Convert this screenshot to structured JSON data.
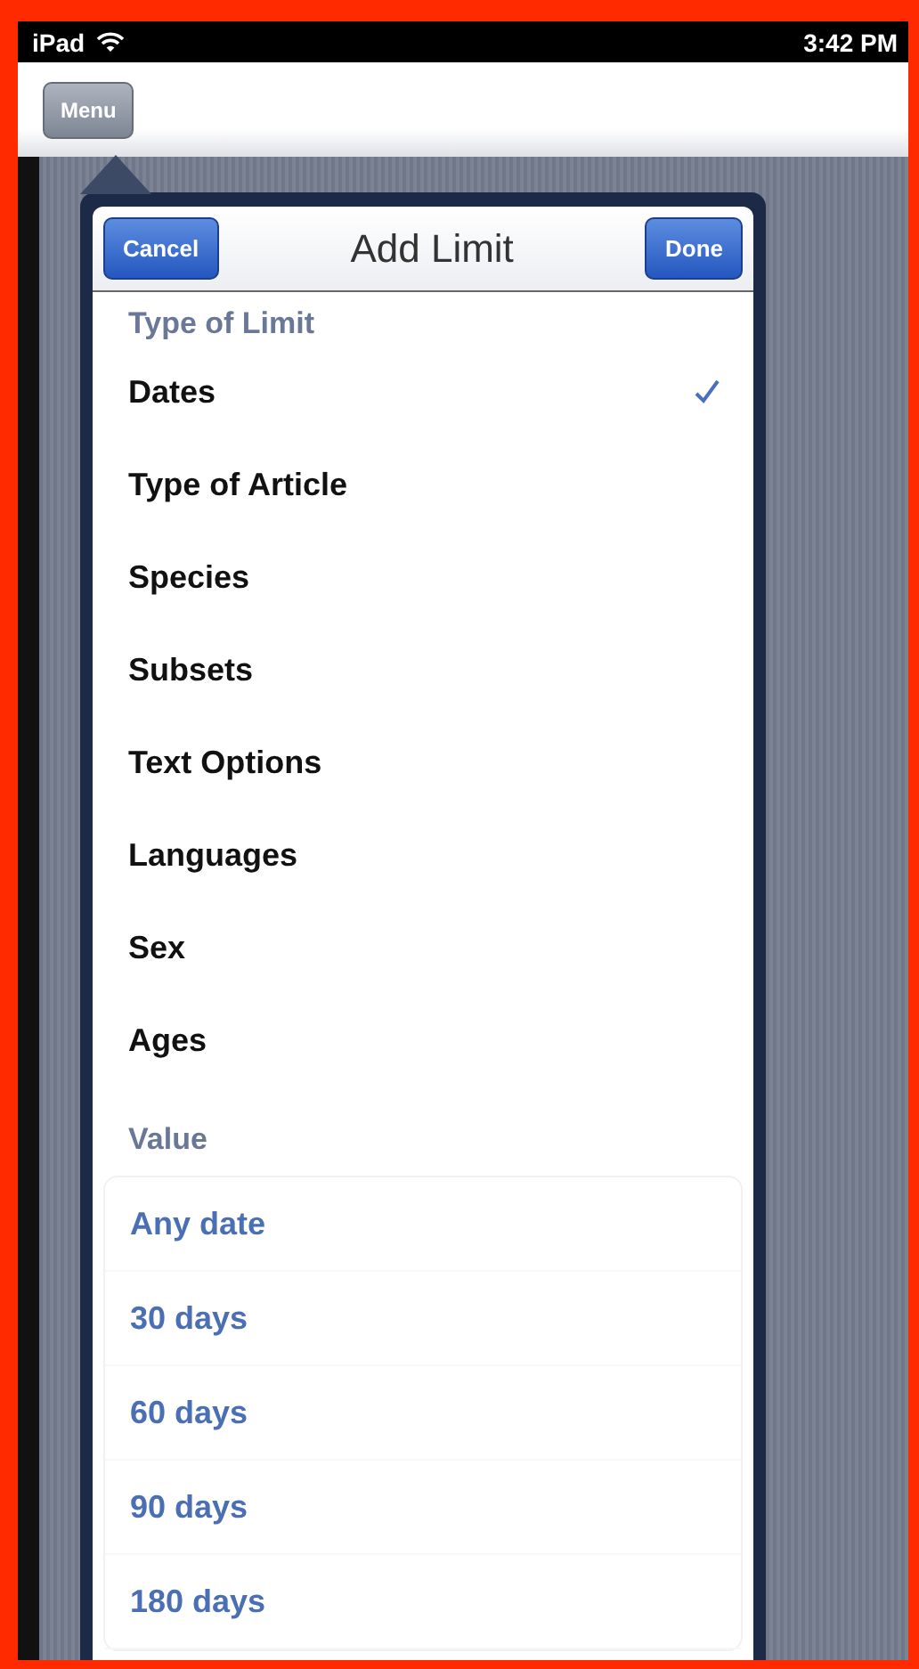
{
  "status_bar": {
    "device": "iPad",
    "time": "3:42 PM"
  },
  "nav_bar": {
    "menu_button": "Menu"
  },
  "popover": {
    "title": "Add Limit",
    "cancel_button": "Cancel",
    "done_button": "Done",
    "type_section": {
      "header": "Type of Limit",
      "items": [
        {
          "label": "Dates",
          "selected": true
        },
        {
          "label": "Type of Article",
          "selected": false
        },
        {
          "label": "Species",
          "selected": false
        },
        {
          "label": "Subsets",
          "selected": false
        },
        {
          "label": "Text Options",
          "selected": false
        },
        {
          "label": "Languages",
          "selected": false
        },
        {
          "label": "Sex",
          "selected": false
        },
        {
          "label": "Ages",
          "selected": false
        }
      ]
    },
    "value_section": {
      "header": "Value",
      "items": [
        "Any date",
        "30 days",
        "60 days",
        "90 days",
        "180 days"
      ]
    }
  }
}
